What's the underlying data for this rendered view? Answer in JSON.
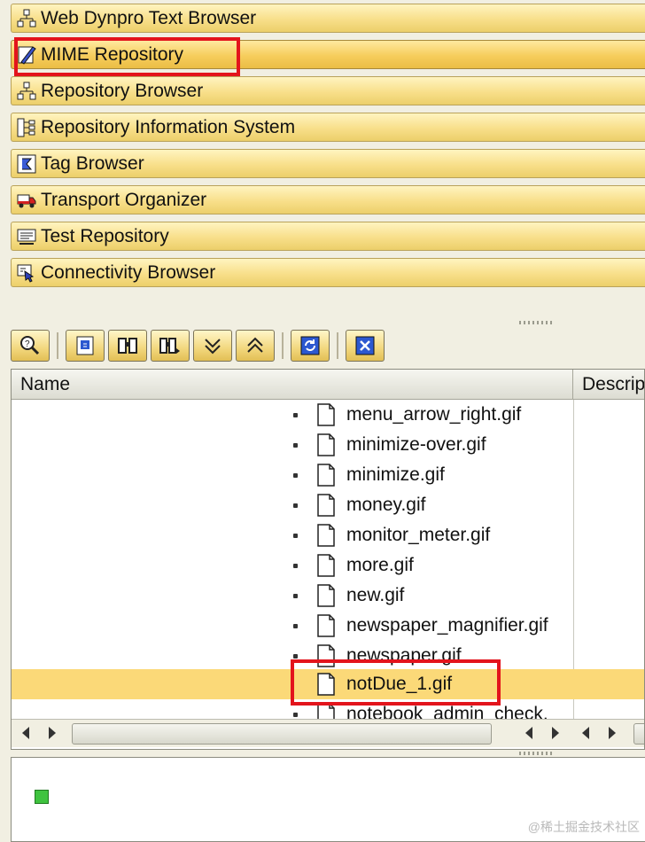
{
  "nav_bars": [
    {
      "label": "Web Dynpro Text Browser",
      "icon": "hierarchy-icon"
    },
    {
      "label": "MIME Repository",
      "icon": "pencil-icon",
      "highlighted": true
    },
    {
      "label": "Repository Browser",
      "icon": "hierarchy-icon"
    },
    {
      "label": "Repository Information System",
      "icon": "tree-structure-icon"
    },
    {
      "label": "Tag Browser",
      "icon": "tag-icon"
    },
    {
      "label": "Transport Organizer",
      "icon": "truck-icon"
    },
    {
      "label": "Test Repository",
      "icon": "test-icon"
    },
    {
      "label": "Connectivity Browser",
      "icon": "connectivity-icon"
    }
  ],
  "toolbar": {
    "buttons": [
      "find-icon",
      "info-icon",
      "binoculars-icon",
      "binoculars-next-icon",
      "expand-icon",
      "collapse-icon",
      "refresh-icon",
      "close-icon"
    ]
  },
  "tree": {
    "columns": [
      "Name",
      "Descrip"
    ],
    "items": [
      {
        "name": "menu_arrow_right.gif"
      },
      {
        "name": "minimize-over.gif"
      },
      {
        "name": "minimize.gif"
      },
      {
        "name": "money.gif"
      },
      {
        "name": "monitor_meter.gif"
      },
      {
        "name": "more.gif"
      },
      {
        "name": "new.gif"
      },
      {
        "name": "newspaper_magnifier.gif"
      },
      {
        "name": "newspaper.gif"
      },
      {
        "name": "notDue_1.gif",
        "selected": true
      },
      {
        "name": "notebook_admin_check."
      }
    ]
  },
  "watermark": "@稀土掘金技术社区",
  "colors": {
    "bar": "#f8df8a",
    "bar_active": "#f6cd5c",
    "selection": "#fbd978",
    "highlight_box": "#e3141c",
    "status_green": "#3fc33f"
  }
}
